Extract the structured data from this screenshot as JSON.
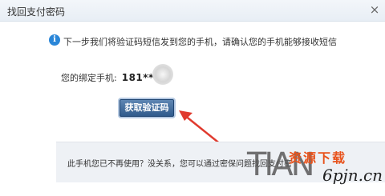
{
  "dialog": {
    "title": "找回支付密码",
    "close_glyph": "×"
  },
  "info": {
    "icon": "info-icon",
    "icon_glyph": "i",
    "text": "下一步我们将验证码短信发到您的手机，请确认您的手机能够接收短信"
  },
  "phone": {
    "label": "您的绑定手机:",
    "number": "181****"
  },
  "actions": {
    "get_code_label": "获取验证码"
  },
  "footer": {
    "text": "此手机您已不再使用？没关系，您可以通过密保问题找回支付密"
  },
  "watermark": {
    "brand": "TIAN",
    "cn_text": "资源下载",
    "url": "6pjn.cn"
  },
  "colors": {
    "button": "#2f5a8c",
    "arrow": "#e03a2e",
    "info_icon": "#2a86d8"
  }
}
